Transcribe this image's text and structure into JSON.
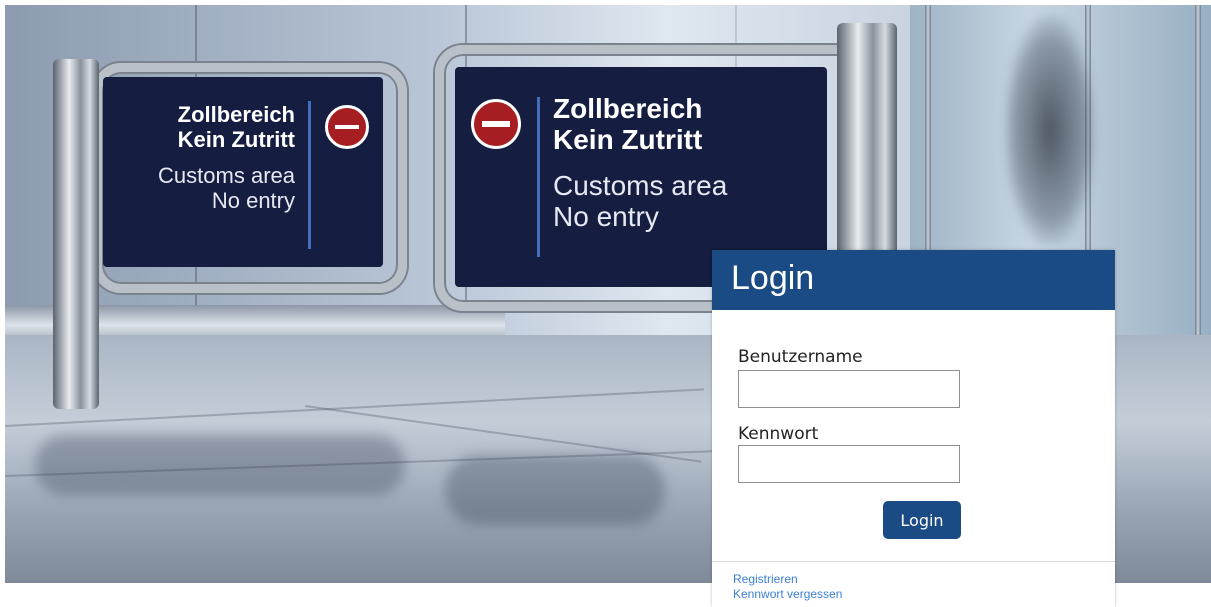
{
  "scene": {
    "sign_left": {
      "line1": "Zollbereich",
      "line2": "Kein Zutritt",
      "line3": "Customs area",
      "line4": "No entry"
    },
    "sign_right": {
      "line1": "Zollbereich",
      "line2": "Kein Zutritt",
      "line3": "Customs area",
      "line4": "No entry"
    }
  },
  "login": {
    "title": "Login",
    "username_label": "Benutzername",
    "username_value": "",
    "password_label": "Kennwort",
    "password_value": "",
    "submit_label": "Login",
    "links": {
      "register": "Registrieren",
      "forgot_password": "Kennwort vergessen"
    }
  },
  "colors": {
    "header": "#1a4b85",
    "button": "#1a4b85",
    "link": "#3b7fd4",
    "sign_background": "#151d40"
  },
  "icons": [
    "no-entry-icon"
  ]
}
